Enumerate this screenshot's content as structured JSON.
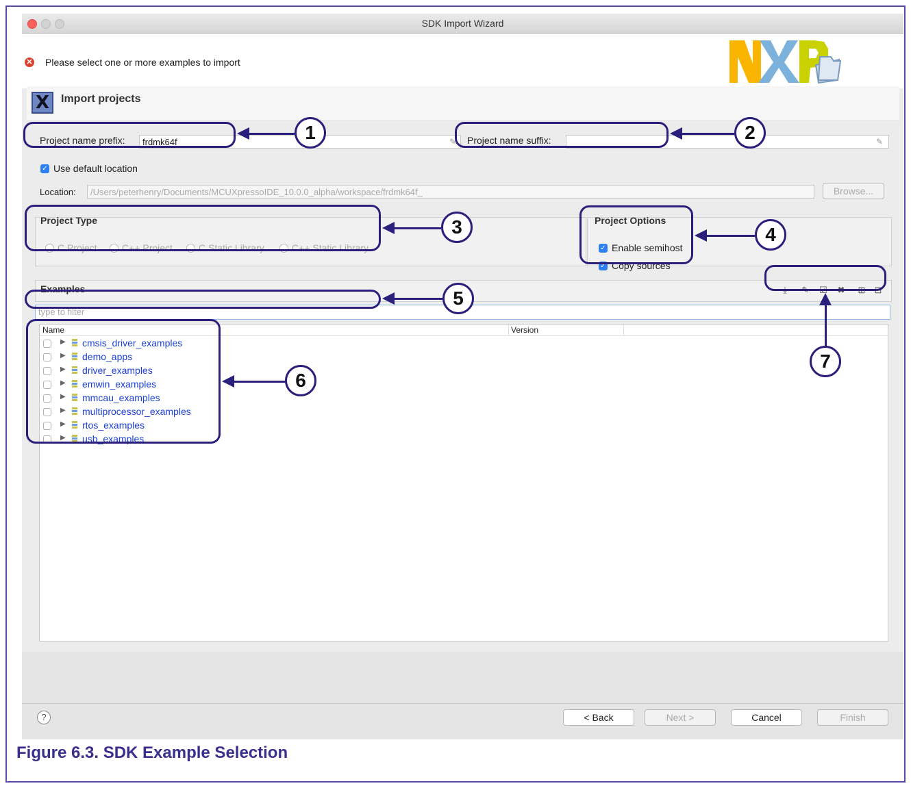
{
  "window": {
    "title": "SDK Import Wizard"
  },
  "message": {
    "text": "Please select one or more examples to import"
  },
  "header": {
    "title": "Import projects"
  },
  "naming": {
    "prefix_label": "Project name prefix:",
    "prefix_value": "frdmk64f_",
    "suffix_label": "Project name suffix:",
    "suffix_value": ""
  },
  "location": {
    "use_default_label": "Use default location",
    "label": "Location:",
    "value": "/Users/peterhenry/Documents/MCUXpressoIDE_10.0.0_alpha/workspace/frdmk64f_",
    "browse_label": "Browse..."
  },
  "project_type": {
    "title": "Project Type",
    "options": [
      "C Project",
      "C++ Project",
      "C Static Library",
      "C++ Static Library"
    ]
  },
  "project_options": {
    "title": "Project Options",
    "semihost_label": "Enable semihost",
    "copy_label": "Copy sources"
  },
  "examples": {
    "title": "Examples",
    "filter_placeholder": "type to filter",
    "col_name": "Name",
    "col_version": "Version",
    "items": [
      "cmsis_driver_examples",
      "demo_apps",
      "driver_examples",
      "emwin_examples",
      "mmcau_examples",
      "multiprocessor_examples",
      "rtos_examples",
      "usb_examples"
    ]
  },
  "buttons": {
    "back": "< Back",
    "next": "Next >",
    "cancel": "Cancel",
    "finish": "Finish",
    "help": "?"
  },
  "callouts": [
    "1",
    "2",
    "3",
    "4",
    "5",
    "6",
    "7"
  ],
  "caption": "Figure 6.3. SDK Example Selection",
  "colors": {
    "annotation": "#2a1f7a",
    "link": "#1a3fd6",
    "checkbox": "#2e7ff0",
    "nxp_yellow": "#f9b500",
    "nxp_blue": "#7bb1db",
    "nxp_green": "#c9d200"
  },
  "icons": [
    "error-icon",
    "nxp-logo",
    "import-x-icon",
    "eraser-icon",
    "checkbox-icon",
    "radio-icon",
    "expand-arrow-icon",
    "project-icon",
    "import-icon",
    "clear-icon",
    "select-all-icon",
    "deselect-icon",
    "expand-all-icon",
    "collapse-all-icon",
    "help-icon"
  ]
}
